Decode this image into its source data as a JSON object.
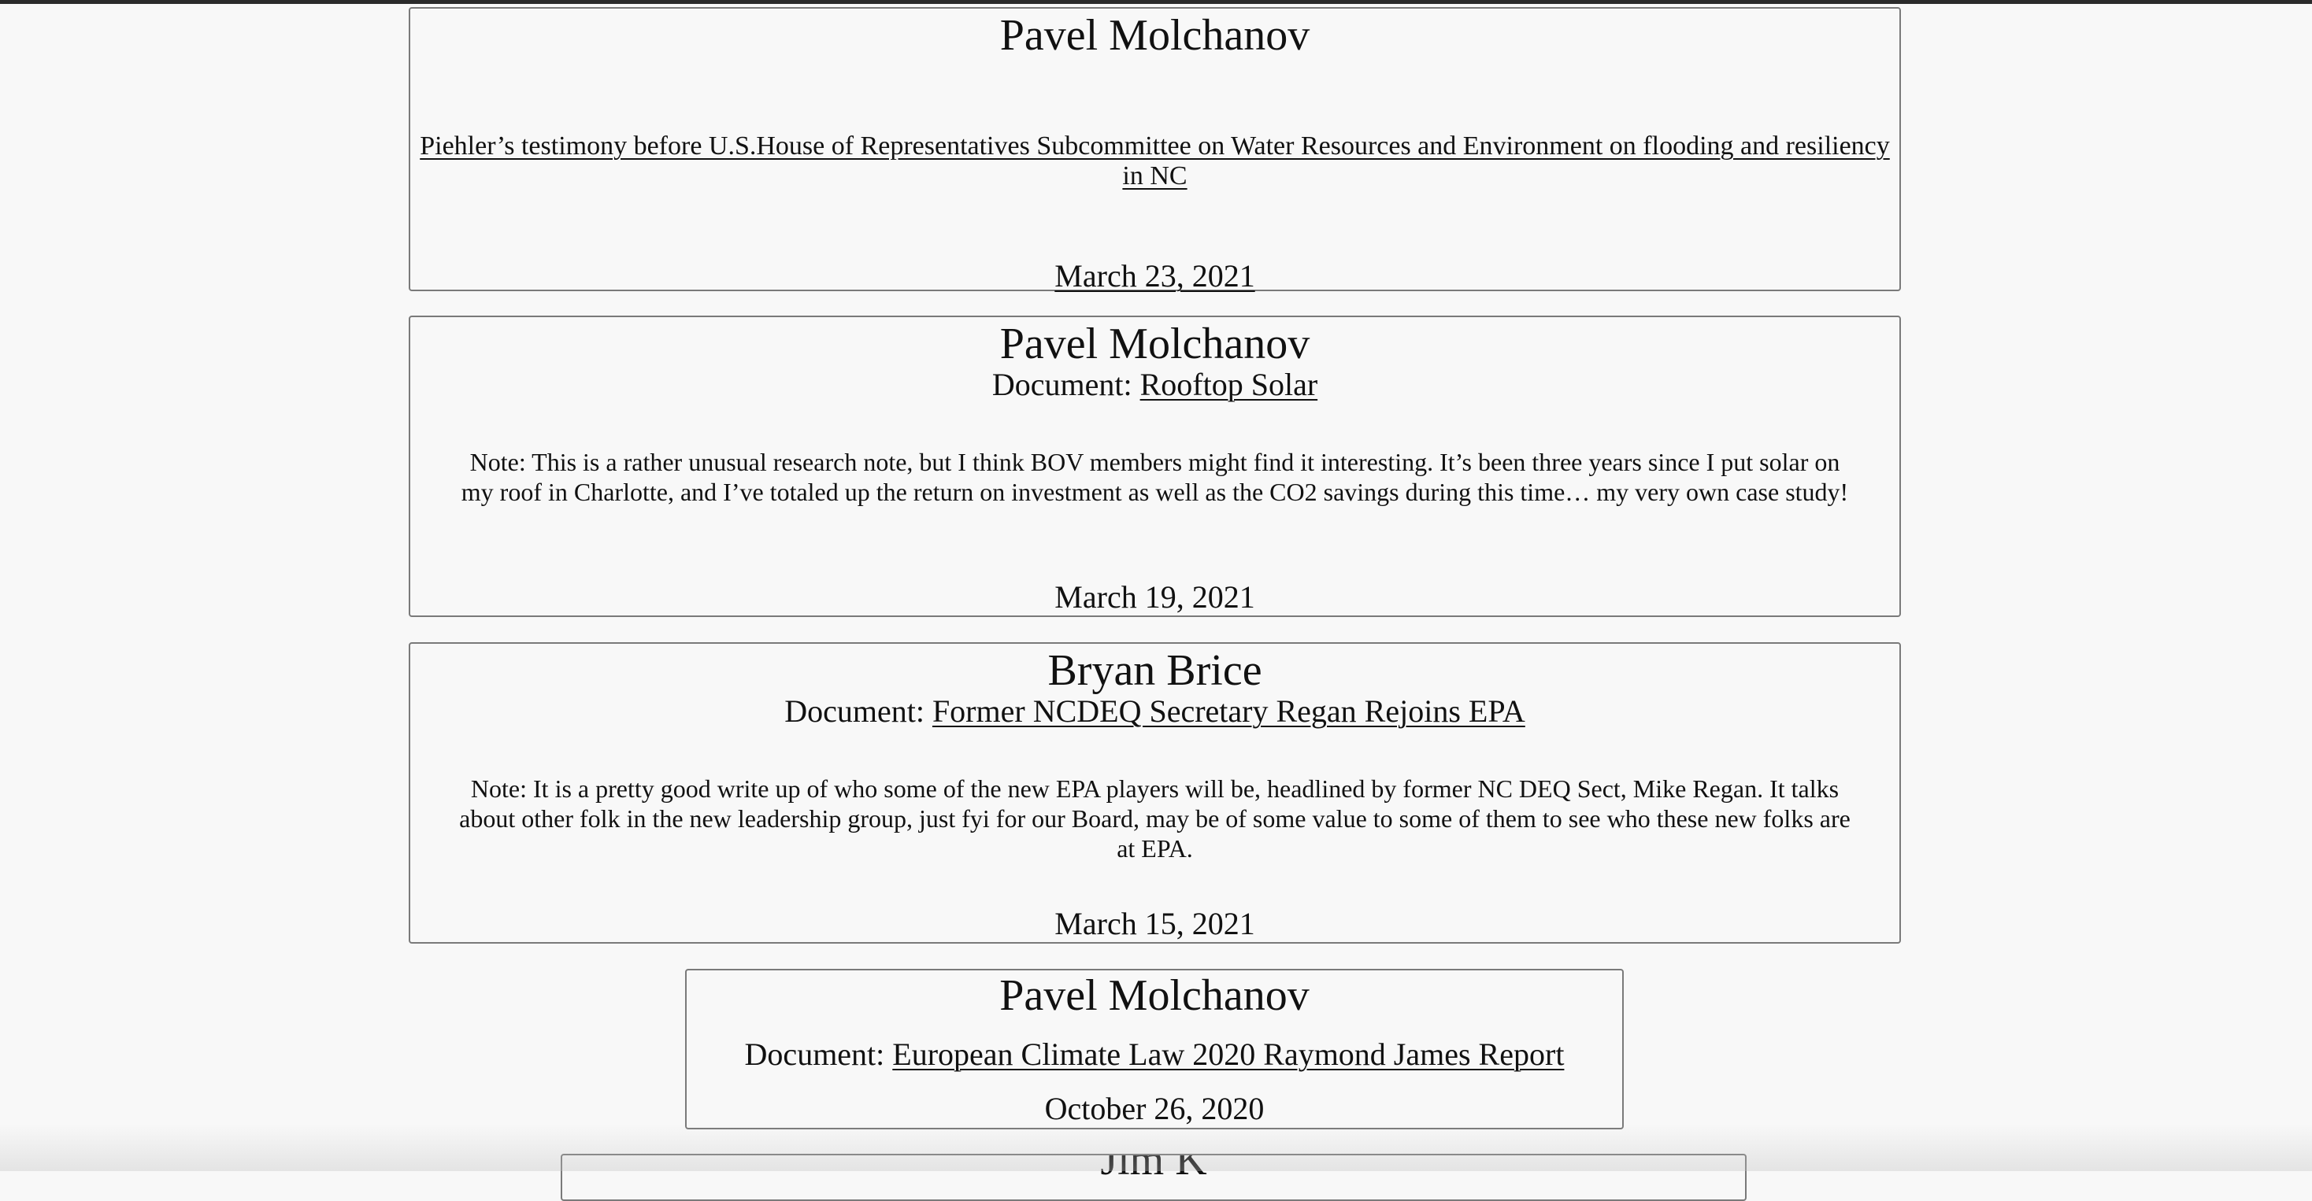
{
  "posts": [
    {
      "author": "Pavel Molchanov",
      "link_text": "Piehler’s testimony before U.S.House of Representatives Subcommittee on Water Resources and Environment on flooding and resiliency in NC",
      "date": " March 23, 2021"
    },
    {
      "author": "Pavel Molchanov",
      "doc_prefix": "Document: ",
      "doc_title": "Rooftop Solar",
      "note": "Note: This is a rather unusual research note, but I think BOV members might find it interesting. It’s been three years since I put solar on my roof in Charlotte, and I’ve totaled up the return on investment as well as the CO2 savings during this time… my very own case study!",
      "date": "March 19, 2021"
    },
    {
      "author": "Bryan Brice",
      "doc_prefix": "Document: ",
      "doc_title": "Former NCDEQ Secretary Regan Rejoins EPA",
      "note": "Note: It is a pretty good write up of who some of the new EPA players will be, headlined by former NC DEQ Sect, Mike Regan. It talks about other folk in the new leadership group, just fyi for our Board, may be of some value to some of them to see who these new folks are at EPA.",
      "date": "March 15, 2021"
    },
    {
      "author": "Pavel Molchanov",
      "doc_prefix": "Document: ",
      "doc_title": "European Climate Law 2020 Raymond James Report",
      "date": "October 26, 2020"
    },
    {
      "author": "Jim K"
    }
  ]
}
